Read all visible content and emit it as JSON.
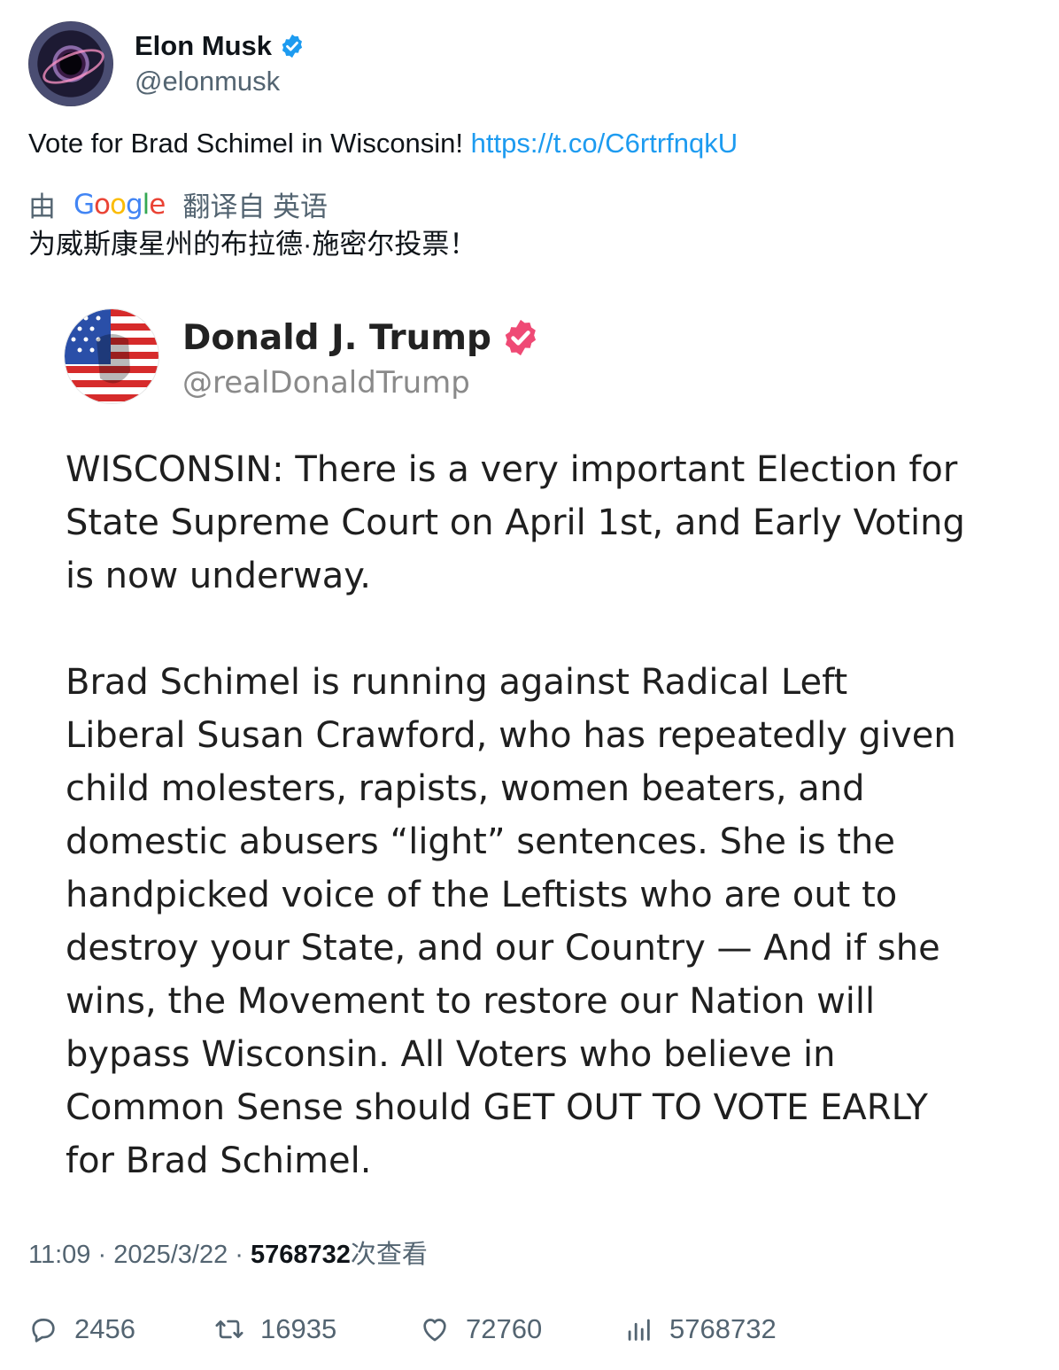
{
  "author": {
    "display_name": "Elon Musk",
    "handle": "@elonmusk",
    "verified_color": "#1d9bf0"
  },
  "tweet": {
    "text": "Vote for Brad Schimel in Wisconsin! ",
    "link": "https://t.co/C6rtrfnqkU"
  },
  "translation": {
    "prefix": "由",
    "provider_letters": [
      "G",
      "o",
      "o",
      "g",
      "l",
      "e"
    ],
    "suffix": "翻译自 英语",
    "text": "为威斯康星州的布拉德·施密尔投票！"
  },
  "embedded_post": {
    "display_name": "Donald J. Trump",
    "handle": "@realDonaldTrump",
    "verified_color": "#ef4a75",
    "paragraphs": [
      "WISCONSIN: There is a very important Election for\nState Supreme Court on April 1st, and Early Voting\nis now underway.",
      "Brad Schimel is running against Radical Left\nLiberal Susan Crawford, who has repeatedly given\nchild molesters, rapists, women beaters, and\ndomestic abusers “light” sentences. She is the\nhandpicked voice of the Leftists who are out to\ndestroy your State, and our Country — And if she\nwins, the Movement to restore our Nation will\nbypass Wisconsin. All Voters who believe in\nCommon Sense should GET OUT TO VOTE EARLY\nfor Brad Schimel."
    ]
  },
  "meta": {
    "time": "11:09",
    "separator": " · ",
    "date": "2025/3/22",
    "views_count": "5768732",
    "views_label": "次查看"
  },
  "actions": {
    "replies": "2456",
    "reposts": "16935",
    "likes": "72760",
    "views": "5768732"
  }
}
